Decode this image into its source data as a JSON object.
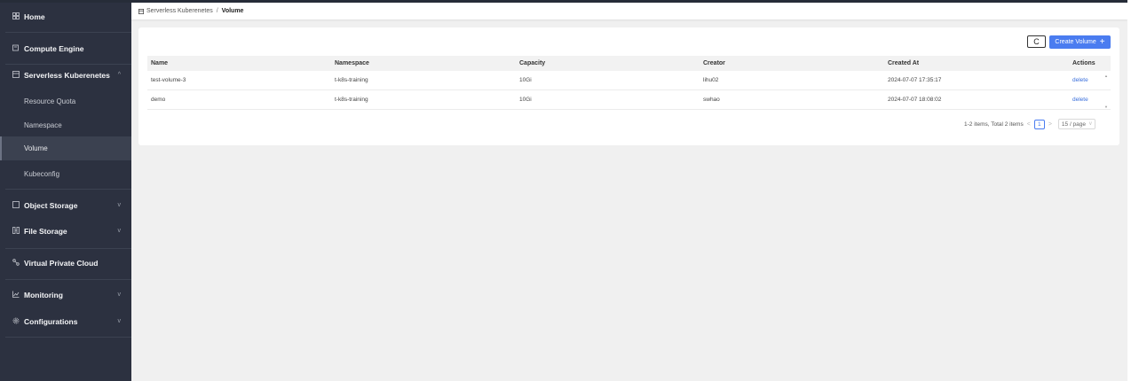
{
  "sidebar": {
    "home": {
      "icon": "grid-icon",
      "label": "Home"
    },
    "compute": {
      "icon": "server-icon",
      "label": "Compute Engine"
    },
    "serverless": {
      "icon": "kubernetes-icon",
      "label": "Serverless Kuberenetes",
      "chevron": "^"
    },
    "sub_items": [
      {
        "label": "Resource Quota"
      },
      {
        "label": "Namespace"
      },
      {
        "label": "Volume"
      },
      {
        "label": "Kubeconfig"
      }
    ],
    "object_storage": {
      "icon": "box-icon",
      "label": "Object Storage",
      "chevron": "v"
    },
    "file_storage": {
      "icon": "folder-icon",
      "label": "File Storage",
      "chevron": "v"
    },
    "vpc": {
      "icon": "network-icon",
      "label": "Virtual Private Cloud"
    },
    "monitoring": {
      "icon": "chart-icon",
      "label": "Monitoring",
      "chevron": "v"
    },
    "configurations": {
      "icon": "gear-icon",
      "label": "Configurations",
      "chevron": "v"
    }
  },
  "breadcrumb": {
    "icon": "kubernetes-icon",
    "parent": "Serverless Kuberenetes",
    "separator": "/",
    "current": "Volume"
  },
  "toolbar": {
    "refresh_icon": "refresh-icon",
    "refresh_glyph": "C",
    "create_label": "Create Volume",
    "create_plus": "+"
  },
  "table": {
    "columns": [
      "Name",
      "Namespace",
      "Capacity",
      "Creator",
      "Created At",
      "Actions"
    ],
    "rows": [
      {
        "name": "test-volume-3",
        "namespace": "t-k8s-training",
        "capacity": "10Gi",
        "creator": "lihu02",
        "created_at": "2024-07-07 17:35:17",
        "action": "delete"
      },
      {
        "name": "demo",
        "namespace": "t-k8s-training",
        "capacity": "10Gi",
        "creator": "swhao",
        "created_at": "2024-07-07 18:08:02",
        "action": "delete"
      }
    ]
  },
  "pagination": {
    "summary": "1-2 items, Total 2 items",
    "prev": "<",
    "current_page": "1",
    "next": ">",
    "page_size": "15 / page",
    "page_size_chevron": "v"
  },
  "colors": {
    "sidebar_bg": "#2c3140",
    "primary": "#4a7cf0",
    "link": "#3a6fdc"
  }
}
